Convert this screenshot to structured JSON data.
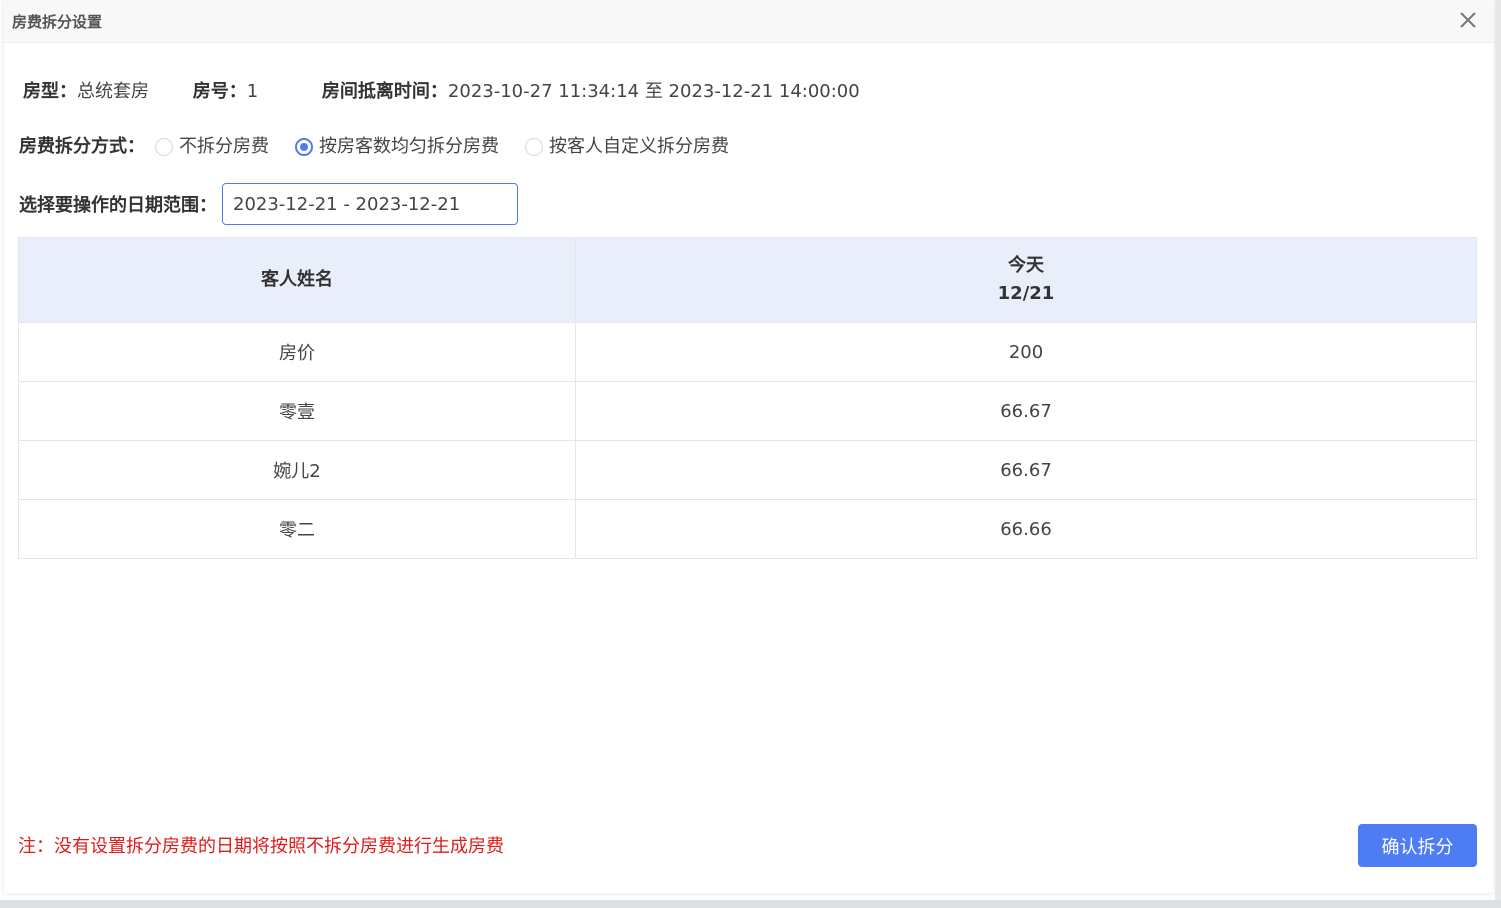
{
  "dialog": {
    "title": "房费拆分设置",
    "close_icon": "close-icon"
  },
  "room_info": {
    "type_label": "房型：",
    "type_value": "总统套房",
    "number_label": "房号：",
    "number_value": "1",
    "period_label": "房间抵离时间：",
    "period_value": "2023-10-27 11:34:14 至 2023-12-21 14:00:00"
  },
  "split_mode": {
    "label": "房费拆分方式：",
    "options": [
      {
        "label": "不拆分房费",
        "checked": false
      },
      {
        "label": "按房客数均匀拆分房费",
        "checked": true
      },
      {
        "label": "按客人自定义拆分房费",
        "checked": false
      }
    ]
  },
  "date_range": {
    "label": "选择要操作的日期范围：",
    "value": "2023-12-21 - 2023-12-21"
  },
  "table": {
    "header_name": "客人姓名",
    "header_day": "今天",
    "header_date": "12/21",
    "rows": [
      {
        "name": "房价",
        "amount": "200"
      },
      {
        "name": "零壹",
        "amount": "66.67"
      },
      {
        "name": "婉儿2",
        "amount": "66.67"
      },
      {
        "name": "零二",
        "amount": "66.66"
      }
    ]
  },
  "note": "注：没有设置拆分房费的日期将按照不拆分房费进行生成房费",
  "confirm_label": "确认拆分",
  "colors": {
    "accent": "#4e7cf2",
    "header_bg": "#e9eefb",
    "note_red": "#e01b1b"
  }
}
